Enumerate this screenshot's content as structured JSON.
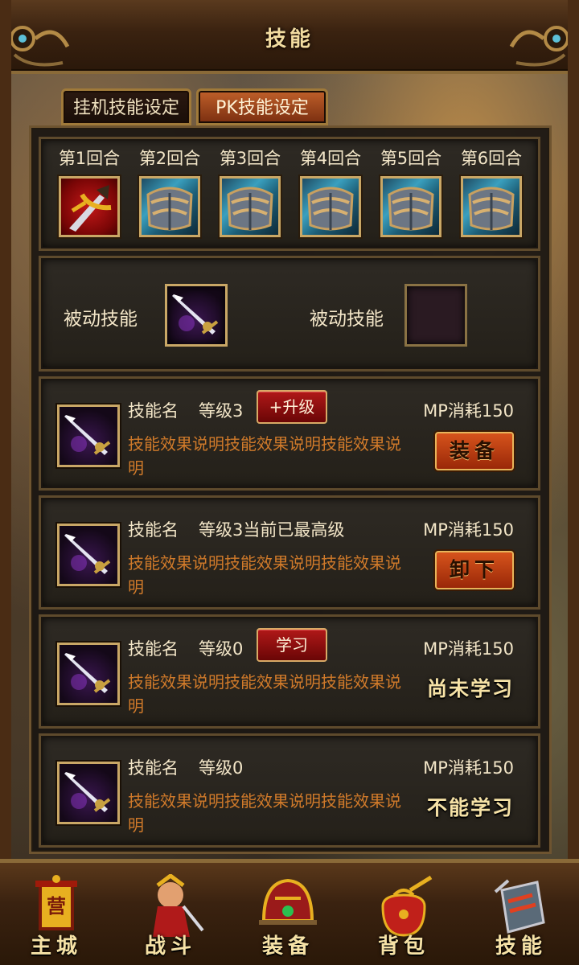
{
  "title": "技能",
  "tabs": [
    {
      "label": "挂机技能设定",
      "active": false
    },
    {
      "label": "PK技能设定",
      "active": true
    }
  ],
  "rounds": [
    {
      "label": "第1回合",
      "icon": "sword-icon"
    },
    {
      "label": "第2回合",
      "icon": "armor-icon"
    },
    {
      "label": "第3回合",
      "icon": "armor-icon"
    },
    {
      "label": "第4回合",
      "icon": "armor-icon"
    },
    {
      "label": "第5回合",
      "icon": "armor-icon"
    },
    {
      "label": "第6回合",
      "icon": "armor-icon"
    }
  ],
  "passives": [
    {
      "label": "被动技能",
      "icon": "spear-icon"
    },
    {
      "label": "被动技能",
      "icon": ""
    }
  ],
  "skills": [
    {
      "name": "技能名",
      "level": "等级3",
      "button": "+升级",
      "mp": "MP消耗150",
      "desc": "技能效果说明技能效果说明技能效果说明",
      "action": "装备",
      "status": ""
    },
    {
      "name": "技能名",
      "level": "等级3当前已最高级",
      "button": "",
      "mp": "MP消耗150",
      "desc": "技能效果说明技能效果说明技能效果说明",
      "action": "卸下",
      "status": ""
    },
    {
      "name": "技能名",
      "level": "等级0",
      "button": "学习",
      "mp": "MP消耗150",
      "desc": "技能效果说明技能效果说明技能效果说明",
      "action": "",
      "status": "尚未学习"
    },
    {
      "name": "技能名",
      "level": "等级0",
      "button": "",
      "mp": "MP消耗150",
      "desc": "技能效果说明技能效果说明技能效果说明",
      "action": "",
      "status": "不能学习"
    }
  ],
  "nav": [
    {
      "label": "主城",
      "icon": "camp-banner-icon",
      "banner": "营"
    },
    {
      "label": "战斗",
      "icon": "warrior-icon"
    },
    {
      "label": "装备",
      "icon": "helmet-icon"
    },
    {
      "label": "背包",
      "icon": "bag-icon"
    },
    {
      "label": "技能",
      "icon": "skill-book-icon"
    }
  ],
  "colors": {
    "accent_gold": "#c9a766",
    "desc_orange": "#d07a2a",
    "button_red": "#b01818",
    "action_orange": "#d6531c"
  }
}
